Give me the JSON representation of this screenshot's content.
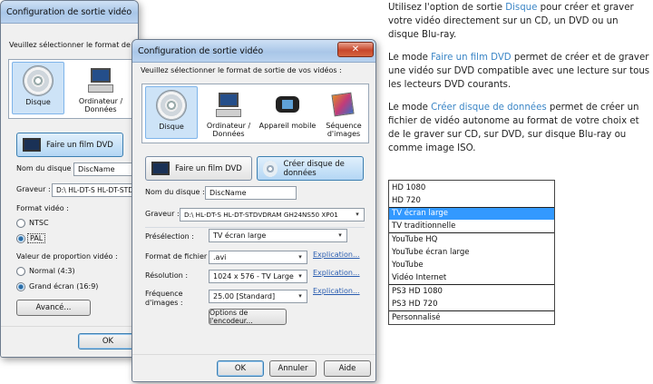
{
  "dialog_back": {
    "title": "Configuration de sortie vidéo",
    "prompt": "Veuillez sélectionner le format de sortie de",
    "formats": [
      {
        "label": "Disque"
      },
      {
        "label": "Ordinateur / Données"
      }
    ],
    "dvd_button": "Faire un film DVD",
    "disc_name_label": "Nom du disque :",
    "disc_name_value": "DiscName",
    "burner_label": "Graveur :",
    "burner_value": "D:\\ HL-DT-S HL-DT-STDV",
    "video_format_label": "Format vidéo :",
    "ntsc_label": "NTSC",
    "pal_label": "PAL",
    "aspect_label": "Valeur de proportion vidéo :",
    "normal_label": "Normal (4:3)",
    "wide_label": "Grand écran (16:9)",
    "advanced_button": "Avancé...",
    "ok_button": "OK"
  },
  "dialog_front": {
    "title": "Configuration de sortie vidéo",
    "prompt": "Veuillez sélectionner le format de sortie de vos vidéos :",
    "formats": [
      {
        "label": "Disque"
      },
      {
        "label": "Ordinateur / Données"
      },
      {
        "label": "Appareil mobile"
      },
      {
        "label": "Séquence d'images"
      }
    ],
    "dvd_button": "Faire un film DVD",
    "data_button": "Créer disque de données",
    "disc_name_label": "Nom du disque :",
    "disc_name_value": "DiscName",
    "burner_label": "Graveur :",
    "burner_value": "D:\\ HL-DT-S HL-DT-STDVDRAM GH24NS50 XP01",
    "preset_label": "Présélection :",
    "preset_value": "TV écran large",
    "file_format_label": "Format de fichier :",
    "file_format_value": ".avi",
    "resolution_label": "Résolution :",
    "resolution_value": "1024 x 576 - TV Large",
    "framerate_label_1": "Fréquence",
    "framerate_label_2": "d'images :",
    "framerate_value": "25.00 [Standard]",
    "explain_link": "Explication...",
    "encoder_button": "Options de l'encodeur...",
    "ok_button": "OK",
    "cancel_button": "Annuler",
    "help_button": "Aide"
  },
  "description": {
    "p1_pre": "Utilisez l'option de sortie ",
    "p1_hl": "Disque",
    "p1_post": " pour créer et graver votre vidéo directement sur un CD, un DVD ou un disque Blu-ray.",
    "p2_pre": "Le mode ",
    "p2_hl": "Faire un film DVD",
    "p2_post": " permet de créer et de graver une vidéo sur DVD compatible avec une lecture sur tous les lecteurs DVD courants.",
    "p3_pre": "Le mode ",
    "p3_hl": "Créer disque de données",
    "p3_post": " permet de créer un fichier de vidéo autonome au format de votre choix et de le graver sur CD, sur DVD, sur disque Blu-ray ou comme image ISO."
  },
  "preset_list": [
    "HD 1080",
    "HD 720",
    "TV écran large",
    "TV traditionnelle",
    "YouTube HQ",
    "YouTube écran large",
    "YouTube",
    "Vidéo Internet",
    "PS3 HD 1080",
    "PS3 HD 720",
    "Personnalisé"
  ],
  "preset_list_selected": "TV écran large",
  "colors": {
    "accent": "#3a85c6",
    "selection": "#3399ff"
  }
}
